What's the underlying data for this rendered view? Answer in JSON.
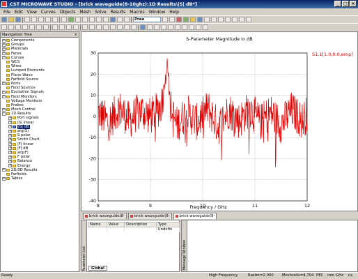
{
  "window": {
    "title": "CST MICROWAVE STUDIO - [brick waveguide(8-10ghz):1D Results\\|S| dB*]",
    "controls": [
      "_",
      "□",
      "×"
    ]
  },
  "menu": [
    "File",
    "Edit",
    "View",
    "Curves",
    "Objects",
    "Mesh",
    "Solve",
    "Results",
    "Macros",
    "Window",
    "Help"
  ],
  "toolbar": {
    "combo_value": "Pree"
  },
  "nav": {
    "title": "Navigation Tree",
    "close": "×",
    "items": [
      {
        "label": "Components",
        "depth": 0,
        "exp": "+"
      },
      {
        "label": "Groups",
        "depth": 0,
        "exp": "+"
      },
      {
        "label": "Materials",
        "depth": 0,
        "exp": "+"
      },
      {
        "label": "Faces",
        "depth": 0,
        "exp": "+"
      },
      {
        "label": "Curves",
        "depth": 0,
        "exp": "+"
      },
      {
        "label": "WCS",
        "depth": 0,
        "exp": ""
      },
      {
        "label": "Wires",
        "depth": 0,
        "exp": ""
      },
      {
        "label": "Lumped Elements",
        "depth": 0,
        "exp": ""
      },
      {
        "label": "Plane Wave",
        "depth": 0,
        "exp": ""
      },
      {
        "label": "Farfield Source",
        "depth": 0,
        "exp": ""
      },
      {
        "label": "Ports",
        "depth": 0,
        "exp": "+"
      },
      {
        "label": "Field Sources",
        "depth": 0,
        "exp": ""
      },
      {
        "label": "Excitation Signals",
        "depth": 0,
        "exp": "+"
      },
      {
        "label": "Field Monitors",
        "depth": 0,
        "exp": "+"
      },
      {
        "label": "Voltage Monitors",
        "depth": 0,
        "exp": ""
      },
      {
        "label": "Probes",
        "depth": 0,
        "exp": ""
      },
      {
        "label": "Mesh Control",
        "depth": 0,
        "exp": "+"
      },
      {
        "label": "1D Results",
        "depth": 0,
        "exp": "-"
      },
      {
        "label": "Port signals",
        "depth": 1,
        "exp": "+"
      },
      {
        "label": "|S| linear",
        "depth": 1,
        "exp": "+"
      },
      {
        "label": "|S| dB",
        "depth": 1,
        "exp": "+",
        "selected": true
      },
      {
        "label": "arg(S)",
        "depth": 1,
        "exp": "+"
      },
      {
        "label": "S polar",
        "depth": 1,
        "exp": "+"
      },
      {
        "label": "Smith Chart",
        "depth": 1,
        "exp": "+"
      },
      {
        "label": "|F| linear",
        "depth": 1,
        "exp": "+"
      },
      {
        "label": "|F| dB",
        "depth": 1,
        "exp": "+"
      },
      {
        "label": "arg(F)",
        "depth": 1,
        "exp": "+"
      },
      {
        "label": "F polar",
        "depth": 1,
        "exp": "+"
      },
      {
        "label": "Balance",
        "depth": 1,
        "exp": "+"
      },
      {
        "label": "Energy",
        "depth": 1,
        "exp": "+"
      },
      {
        "label": "2D/3D Results",
        "depth": 0,
        "exp": "+"
      },
      {
        "label": "Farfields",
        "depth": 0,
        "exp": ""
      },
      {
        "label": "Tables",
        "depth": 0,
        "exp": "+"
      }
    ]
  },
  "chart_data": {
    "type": "line",
    "title": "S-Parameter Magnitude in dB",
    "xlabel": "Frequency / GHz",
    "ylabel": "",
    "xlim": [
      8,
      12
    ],
    "ylim": [
      -40,
      30
    ],
    "xticks": [
      8,
      9,
      10,
      11,
      12
    ],
    "yticks": [
      30,
      20,
      10,
      0,
      -10,
      -20,
      -30,
      -40
    ],
    "grid": true,
    "series": [
      {
        "name": "S1,1[1.0,0.0,emp]",
        "color": "#e00000",
        "x": [
          8.0,
          8.2,
          8.4,
          8.6,
          8.8,
          9.0,
          9.1,
          9.2,
          9.25,
          9.3,
          9.32,
          9.34,
          9.36,
          9.4,
          9.5,
          9.7,
          9.9,
          10.1,
          10.3,
          10.5,
          10.7,
          10.9,
          11.1,
          11.3,
          11.5,
          11.7,
          11.9,
          12.0
        ],
        "y": [
          2,
          -3,
          4,
          -2,
          3,
          0,
          2,
          5,
          12,
          20,
          28,
          22,
          10,
          3,
          -4,
          2,
          -3,
          4,
          -5,
          3,
          -2,
          4,
          -3,
          2,
          -4,
          3,
          -2,
          1
        ],
        "noise_amplitude": 9
      }
    ],
    "legend_position": "top-right"
  },
  "tabs": [
    {
      "label": "brick waveguide(8-",
      "active": false
    },
    {
      "label": "brick waveguide(8-",
      "active": false
    },
    {
      "label": "brick waveguide(8-",
      "active": true
    }
  ],
  "param_list": {
    "vertical_label": "Parameter List",
    "headers": [
      "Name",
      "Value",
      "Description",
      "Type"
    ],
    "row": [
      "",
      "",
      "",
      "Undefin"
    ],
    "tab": "Global"
  },
  "message_window": {
    "vertical_label": "Message Window"
  },
  "status": {
    "ready": "Ready",
    "items": [
      "High Frequency",
      "Raster=2.000",
      "Meshcells=4,704",
      "PEC",
      "mm",
      "GHz",
      "ns"
    ]
  }
}
